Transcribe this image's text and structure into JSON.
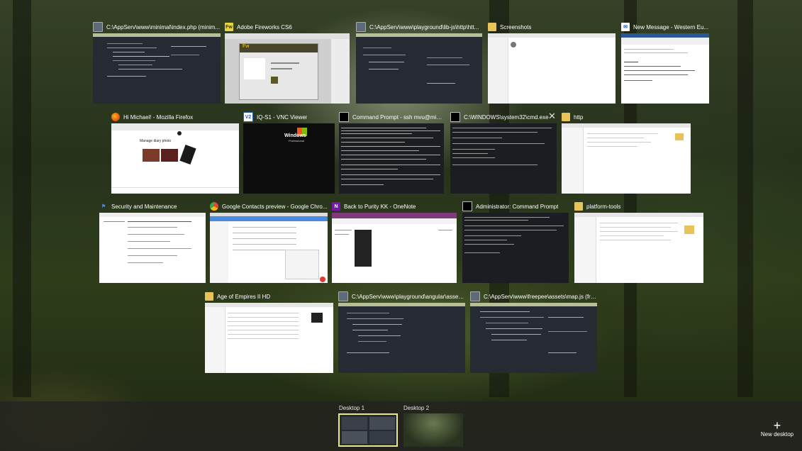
{
  "windows": [
    {
      "title": "C:\\AppServ\\www\\minimal\\index.php (minim...",
      "icon": "code-editor-icon"
    },
    {
      "title": "Adobe Fireworks CS6",
      "icon": "fireworks-icon"
    },
    {
      "title": "C:\\AppServ\\www\\playground\\lib-js\\http\\htt...",
      "icon": "code-editor-icon"
    },
    {
      "title": "Screenshots",
      "icon": "folder-icon"
    },
    {
      "title": "New Message - Western Eu...",
      "icon": "mail-icon"
    },
    {
      "title": "Hi Michael! - Mozilla Firefox",
      "icon": "firefox-icon"
    },
    {
      "title": "IQ-S1 - VNC Viewer",
      "icon": "vnc-icon"
    },
    {
      "title": "Command Prompt - ssh  mvu@mic...",
      "icon": "terminal-icon"
    },
    {
      "title": "C:\\WINDOWS\\system32\\cmd.exe",
      "icon": "terminal-icon"
    },
    {
      "title": "http",
      "icon": "folder-icon"
    },
    {
      "title": "Security and Maintenance",
      "icon": "flag-icon"
    },
    {
      "title": "Google Contacts preview - Google Chro...",
      "icon": "chrome-icon"
    },
    {
      "title": "Back to Purity KK - OneNote",
      "icon": "onenote-icon"
    },
    {
      "title": "Administrator: Command Prompt",
      "icon": "terminal-icon"
    },
    {
      "title": "platform-tools",
      "icon": "folder-icon"
    },
    {
      "title": "Age of Empires II HD",
      "icon": "folder-icon"
    },
    {
      "title": "C:\\AppServ\\www\\playground\\angular\\assets...",
      "icon": "code-editor-icon"
    },
    {
      "title": "C:\\AppServ\\www\\freepee\\assets\\map.js (free...",
      "icon": "code-editor-icon"
    }
  ],
  "thumb_text": {
    "fireworks_logo": "Fw",
    "firefox_heading": "Manage diary photo",
    "vnc_brand": "Windows",
    "vnc_edition": "Professional"
  },
  "close_glyph": "✕",
  "desktops": {
    "items": [
      {
        "label": "Desktop 1",
        "active": true
      },
      {
        "label": "Desktop 2",
        "active": false
      }
    ],
    "new_desktop_label": "New desktop",
    "new_desktop_glyph": "+"
  },
  "colors": {
    "active_outline": "#e8e88a",
    "taskbar": "#23231e",
    "code_bg": "#262b33",
    "code_header": "#b9bf94"
  }
}
